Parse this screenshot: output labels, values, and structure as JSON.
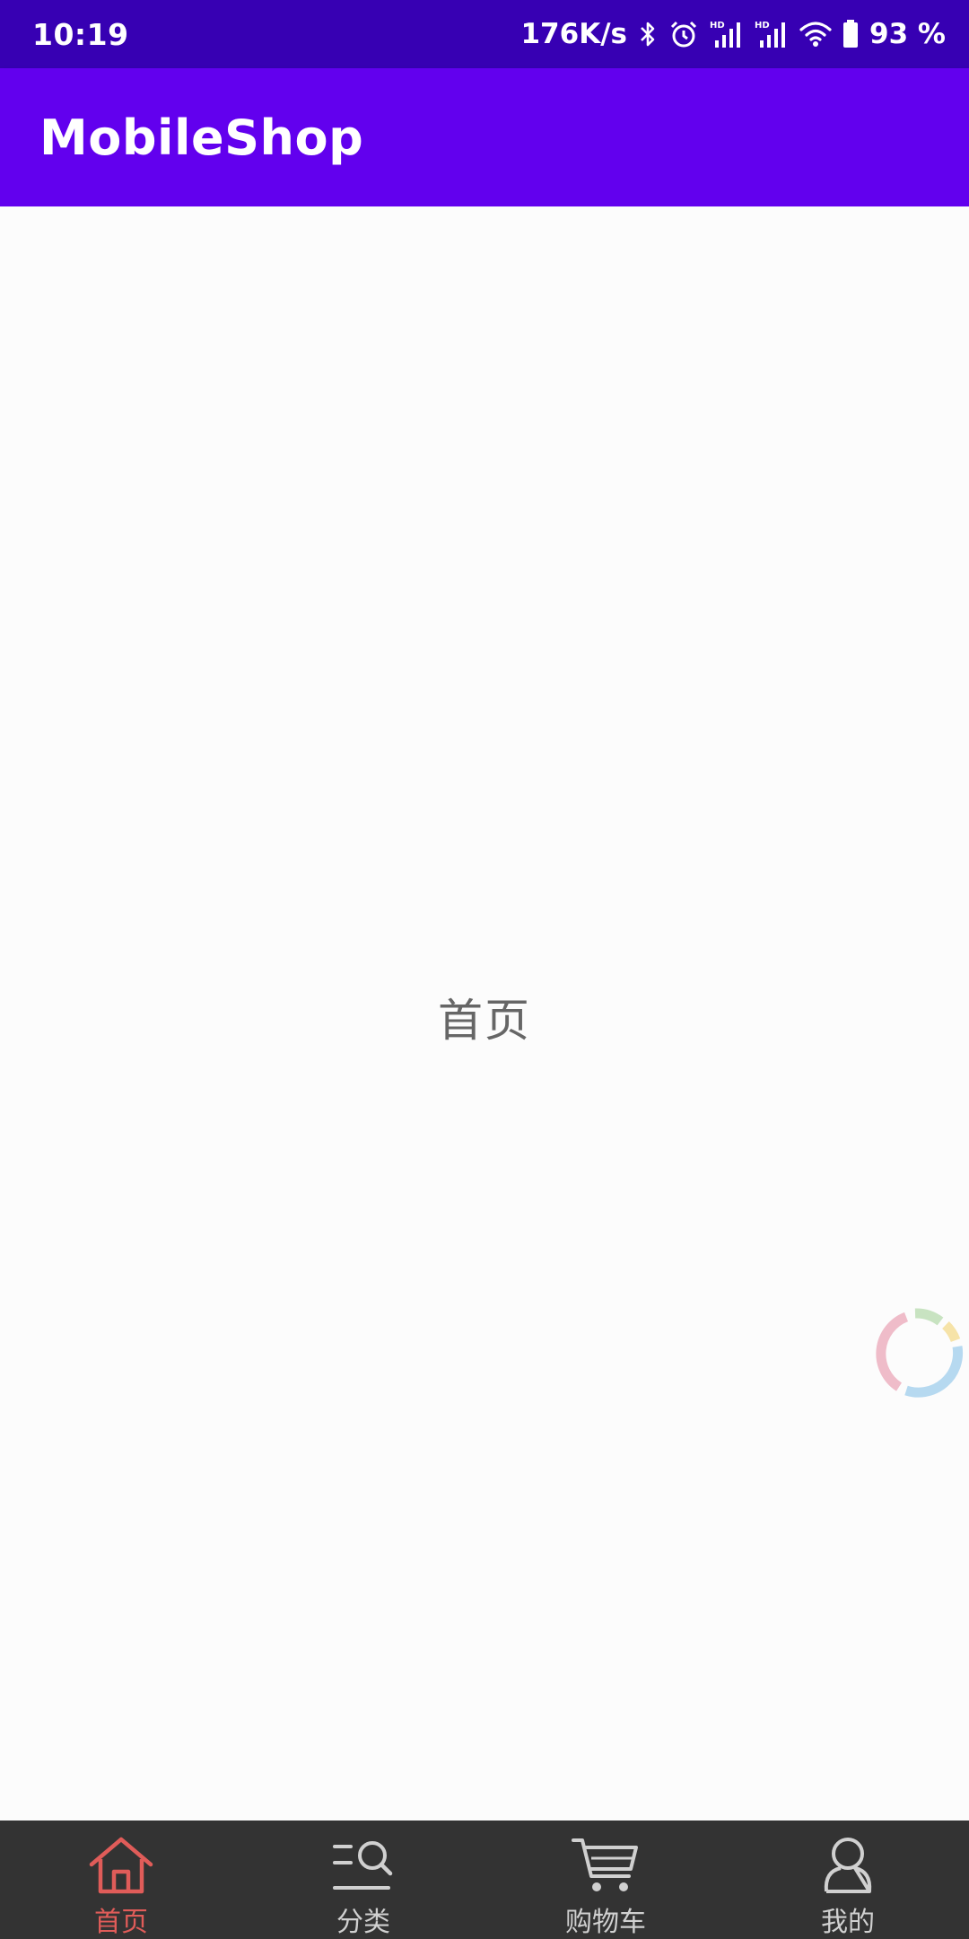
{
  "status_bar": {
    "time": "10:19",
    "net_speed": "176K/s",
    "battery": "93 %",
    "icons": [
      "bluetooth-icon",
      "alarm-icon",
      "hd-signal-icon",
      "hd-signal-icon",
      "wifi-icon",
      "battery-icon"
    ]
  },
  "app_bar": {
    "title": "MobileShop"
  },
  "main": {
    "center_text": "首页"
  },
  "bottom_nav": {
    "items": [
      {
        "label": "首页",
        "icon": "home-icon",
        "active": true
      },
      {
        "label": "分类",
        "icon": "category-search-icon",
        "active": false
      },
      {
        "label": "购物车",
        "icon": "cart-icon",
        "active": false
      },
      {
        "label": "我的",
        "icon": "profile-icon",
        "active": false
      }
    ]
  },
  "colors": {
    "status_bar": "#3700b3",
    "app_bar": "#6200ee",
    "nav_bar": "#333333",
    "nav_active": "#e05c59",
    "nav_inactive": "#d0d0d0"
  }
}
